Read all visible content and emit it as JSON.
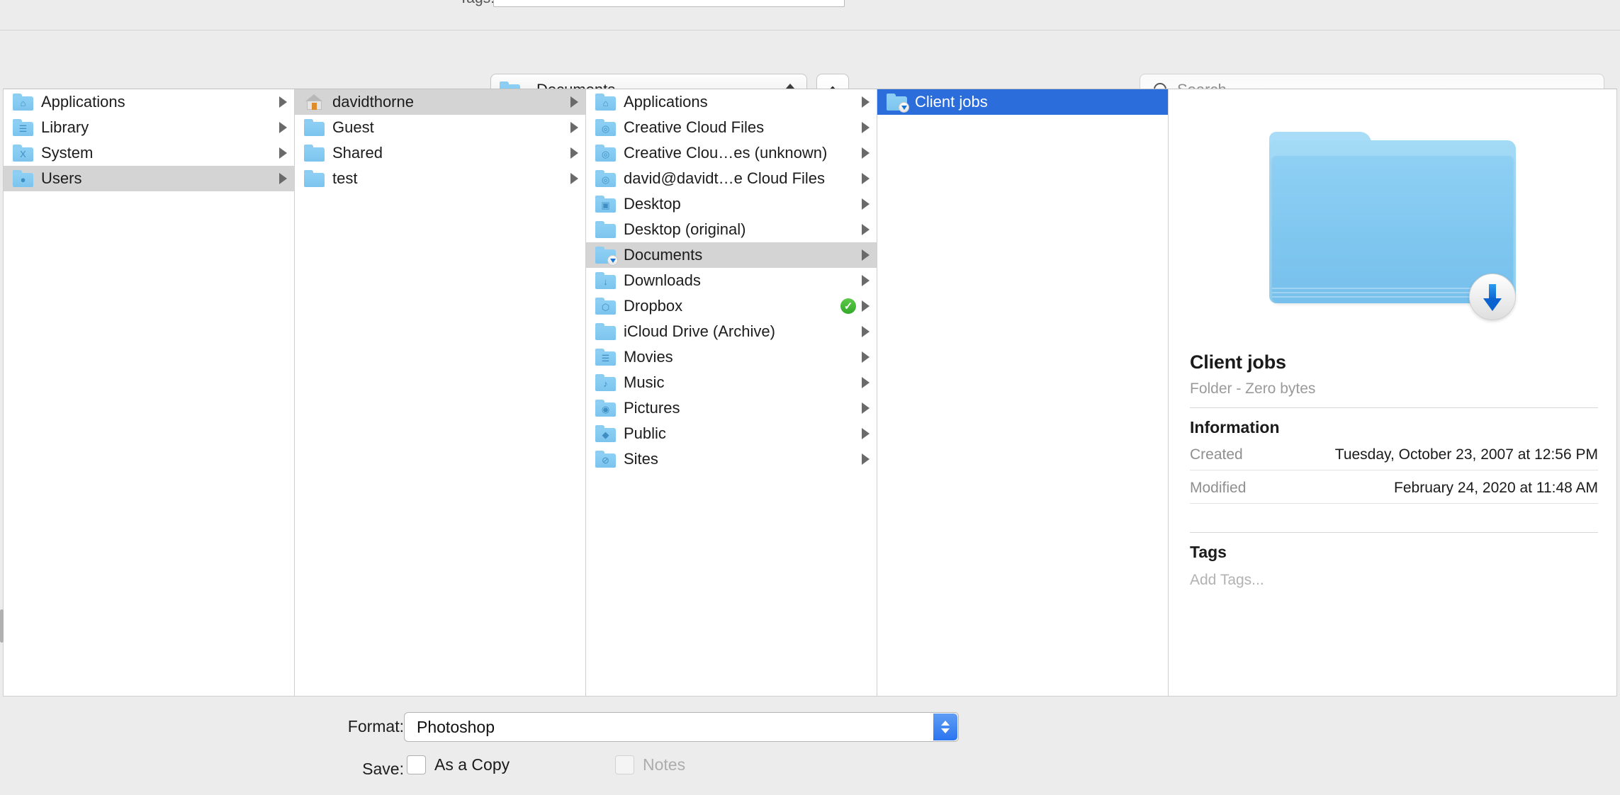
{
  "tags_row": {
    "label": "Tags:",
    "value": "",
    "placeholder": ""
  },
  "toolbar": {
    "path_popup": {
      "label": "Documents",
      "icon": "folder-download-icon"
    },
    "up_button": {
      "icon": "chevron-up-icon"
    },
    "search": {
      "placeholder": "Search",
      "value": "",
      "icon": "search-icon"
    }
  },
  "columns": [
    {
      "name": "column-volume",
      "items": [
        {
          "label": "Applications",
          "icon": "folder-applications-icon",
          "glyph": "⌂",
          "selected": false,
          "disclosure": true
        },
        {
          "label": "Library",
          "icon": "folder-library-icon",
          "glyph": "☰",
          "selected": false,
          "disclosure": true
        },
        {
          "label": "System",
          "icon": "folder-system-icon",
          "glyph": "X",
          "selected": false,
          "disclosure": true
        },
        {
          "label": "Users",
          "icon": "folder-users-icon",
          "glyph": "●",
          "selected": "inactive",
          "disclosure": true
        }
      ]
    },
    {
      "name": "column-users",
      "items": [
        {
          "label": "davidthorne",
          "icon": "home-folder-icon",
          "glyph": "",
          "selected": "inactive",
          "disclosure": true
        },
        {
          "label": "Guest",
          "icon": "folder-icon",
          "glyph": "",
          "selected": false,
          "disclosure": true
        },
        {
          "label": "Shared",
          "icon": "folder-icon",
          "glyph": "",
          "selected": false,
          "disclosure": true
        },
        {
          "label": "test",
          "icon": "folder-icon",
          "glyph": "",
          "selected": false,
          "disclosure": true
        }
      ]
    },
    {
      "name": "column-home",
      "items": [
        {
          "label": "Applications",
          "icon": "folder-applications-icon",
          "glyph": "⌂",
          "selected": false,
          "disclosure": true
        },
        {
          "label": "Creative Cloud Files",
          "icon": "folder-creativecloud-icon",
          "glyph": "◎",
          "selected": false,
          "disclosure": true
        },
        {
          "label": "Creative Clou…es (unknown)",
          "icon": "folder-creativecloud-icon",
          "glyph": "◎",
          "selected": false,
          "disclosure": true
        },
        {
          "label": "david@davidt…e Cloud Files",
          "icon": "folder-creativecloud-icon",
          "glyph": "◎",
          "selected": false,
          "disclosure": true
        },
        {
          "label": "Desktop",
          "icon": "folder-desktop-icon",
          "glyph": "▣",
          "selected": false,
          "disclosure": true
        },
        {
          "label": "Desktop (original)",
          "icon": "folder-icon",
          "glyph": "",
          "selected": false,
          "disclosure": true
        },
        {
          "label": "Documents",
          "icon": "folder-download-icon",
          "glyph": "",
          "selected": "inactive",
          "disclosure": true,
          "badge": "download"
        },
        {
          "label": "Downloads",
          "icon": "folder-downloads-icon",
          "glyph": "↓",
          "selected": false,
          "disclosure": true
        },
        {
          "label": "Dropbox",
          "icon": "folder-dropbox-icon",
          "glyph": "⬡",
          "selected": false,
          "disclosure": true,
          "status": "synced",
          "status_icon": "green-check-icon"
        },
        {
          "label": "iCloud Drive (Archive)",
          "icon": "folder-icon",
          "glyph": "",
          "selected": false,
          "disclosure": true
        },
        {
          "label": "Movies",
          "icon": "folder-movies-icon",
          "glyph": "☰",
          "selected": false,
          "disclosure": true
        },
        {
          "label": "Music",
          "icon": "folder-music-icon",
          "glyph": "♪",
          "selected": false,
          "disclosure": true
        },
        {
          "label": "Pictures",
          "icon": "folder-pictures-icon",
          "glyph": "◉",
          "selected": false,
          "disclosure": true
        },
        {
          "label": "Public",
          "icon": "folder-public-icon",
          "glyph": "◆",
          "selected": false,
          "disclosure": true
        },
        {
          "label": "Sites",
          "icon": "folder-sites-icon",
          "glyph": "⊘",
          "selected": false,
          "disclosure": true
        }
      ]
    },
    {
      "name": "column-documents",
      "items": [
        {
          "label": "Client jobs",
          "icon": "folder-download-icon",
          "glyph": "",
          "selected": "active",
          "disclosure": false,
          "badge": "download"
        }
      ]
    }
  ],
  "preview": {
    "icon": "folder-download-large-icon",
    "title": "Client jobs",
    "subtitle": "Folder - Zero bytes",
    "information_heading": "Information",
    "rows": [
      {
        "key": "Created",
        "value": "Tuesday, October 23, 2007 at 12:56 PM"
      },
      {
        "key": "Modified",
        "value": "February 24, 2020 at 11:48 AM"
      }
    ],
    "tags_heading": "Tags",
    "tags_placeholder": "Add Tags..."
  },
  "bottom": {
    "format_label": "Format:",
    "format_value": "Photoshop",
    "save_label": "Save:",
    "as_a_copy_label": "As a Copy",
    "as_a_copy_checked": false,
    "notes_label": "Notes",
    "notes_checked": false,
    "notes_disabled": true
  },
  "colors": {
    "selection_active": "#2a6ddb",
    "selection_inactive": "#d4d4d4",
    "folder_blue": "#7cc4ee",
    "accent_stepper": "#2a74ef",
    "sync_green": "#3aae2c"
  }
}
